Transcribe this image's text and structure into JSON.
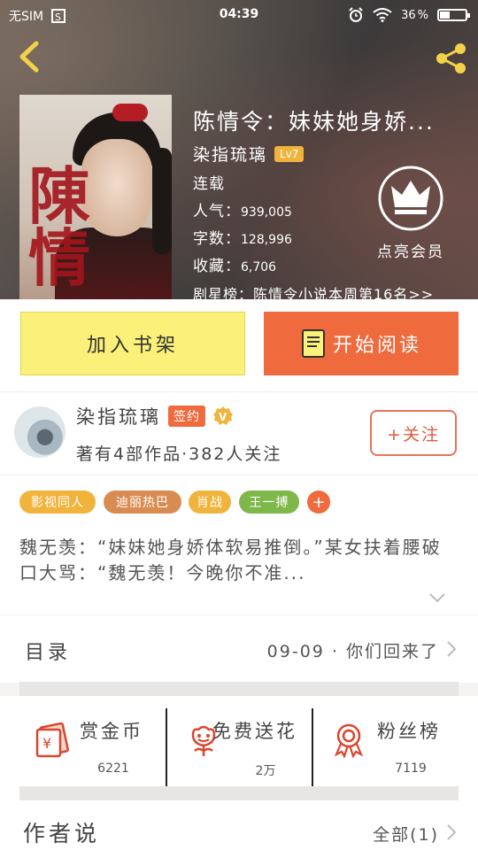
{
  "status_bar": {
    "carrier": "无SIM",
    "time": "04:39",
    "battery": "36"
  },
  "book": {
    "title": "陈情令：妹妹她身娇...",
    "author": "染指琉璃",
    "level_badge": "Lv7",
    "status": "连载",
    "popularity_label": "人气：",
    "popularity": "939,005",
    "word_count_label": "字数：",
    "word_count": "128,996",
    "favorites_label": "收藏：",
    "favorites": "6,706",
    "rank_text": "剧星榜：陈情令小说本周第16名>>",
    "vip_label": "点亮会员"
  },
  "actions": {
    "add_shelf": "加入书架",
    "start_read": "开始阅读"
  },
  "author_card": {
    "name": "染指琉璃",
    "sign_badge": "签约",
    "meta": "著有4部作品·382人关注",
    "follow": "+关注"
  },
  "tags": [
    {
      "label": "影视同人",
      "color": "#f0b43c"
    },
    {
      "label": "迪丽热巴",
      "color": "#d98c52"
    },
    {
      "label": "肖战",
      "color": "#f0b43c"
    },
    {
      "label": "王一搏",
      "color": "#7fb84a"
    }
  ],
  "tag_more": "+",
  "description": "魏无羡：“妹妹她身娇体软易推倒。”某女扶着腰破口大骂：“魏无羡！今晚你不准...",
  "toc": {
    "label": "目录",
    "latest": "09-09 · 你们回来了"
  },
  "stats": [
    {
      "name": "赏金币",
      "value": "6221",
      "icon": "red-envelope-icon"
    },
    {
      "name": "免费送花",
      "value": "2万",
      "icon": "flower-icon"
    },
    {
      "name": "粉丝榜",
      "value": "7119",
      "icon": "award-ribbon-icon"
    }
  ],
  "author_says": {
    "title": "作者说",
    "all": "全部(1)"
  },
  "colors": {
    "accent_orange": "#ef6a3c",
    "shelf_yellow": "#fbf07a",
    "level_gold": "#f0b43c"
  }
}
